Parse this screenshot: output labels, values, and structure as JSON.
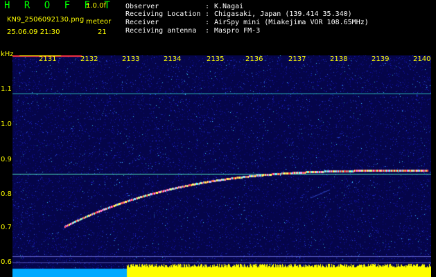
{
  "header": {
    "app_title": "H R O F F T",
    "version": "1.0.0f",
    "filename": "KN9_2506092130.png",
    "method": "meteor",
    "datetime": "25.06.09 21:30",
    "count": "21",
    "info": [
      {
        "key": "Observer",
        "value": "K.Nagai"
      },
      {
        "key": "Receiving Location",
        "value": "Chigasaki, Japan (139.414 35.340)"
      },
      {
        "key": "Receiver",
        "value": "AirSpy mini (Miakejima VOR 108.65MHz)"
      },
      {
        "key": "Receiving antenna",
        "value": "Maspro FM-3"
      }
    ],
    "separator": ":"
  },
  "axes": {
    "y_unit": "kHz",
    "y_ticks": [
      "1.1",
      "1.0",
      "0.9",
      "0.8",
      "0.7",
      "0.6"
    ],
    "x_ticks": [
      "2131",
      "2132",
      "2133",
      "2134",
      "2135",
      "2136",
      "2137",
      "2138",
      "2139",
      "2140"
    ]
  },
  "colors": {
    "header_text": "#ffffff",
    "accent_green": "#00ff00",
    "label_yellow": "#ffff00",
    "noise_blue": "#0a0a7a",
    "level_bar": "#ffff00",
    "level_bar_low": "#00ccff"
  }
}
